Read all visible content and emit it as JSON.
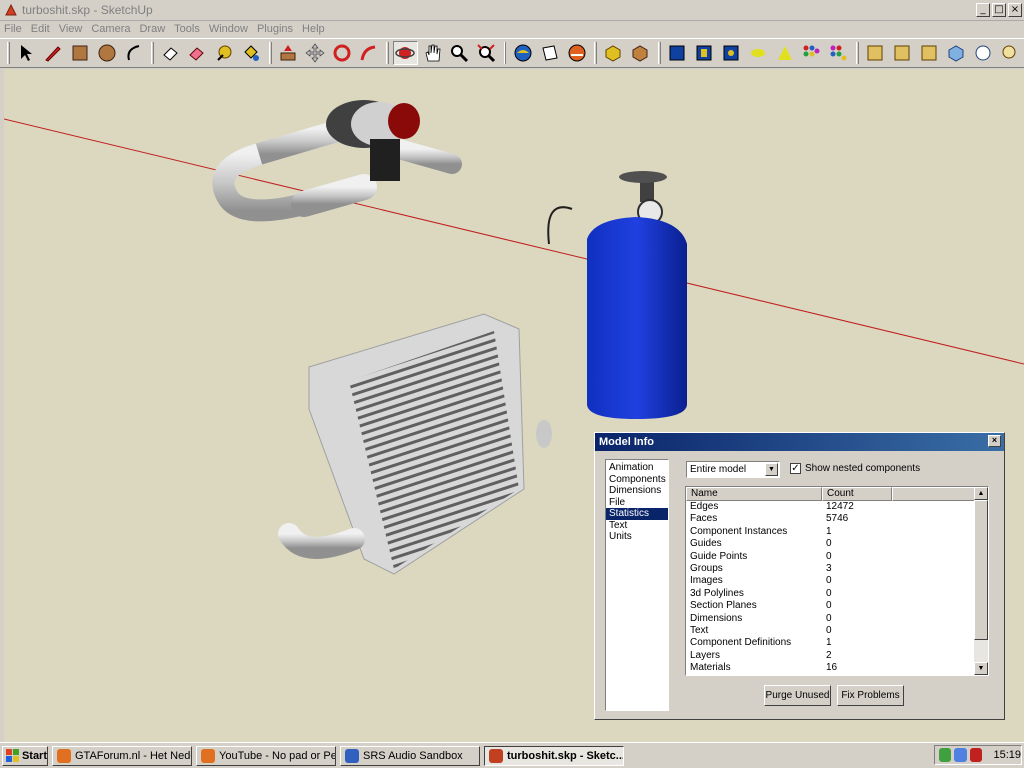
{
  "window": {
    "title": "turboshit.skp - SketchUp",
    "minimize": "_",
    "maximize": "□",
    "close": "×"
  },
  "menu": [
    "File",
    "Edit",
    "View",
    "Camera",
    "Draw",
    "Tools",
    "Window",
    "Plugins",
    "Help"
  ],
  "toolbar": {
    "tools": [
      "select-tool-icon",
      "pencil-icon",
      "rectangle-icon",
      "circle-icon",
      "arc-icon",
      "eraser-icon",
      "paint-bucket-icon",
      "tape-measure-icon",
      "push-pull-icon",
      "move-icon",
      "rotate-icon",
      "follow-me-icon",
      "orbit-icon",
      "pan-icon",
      "zoom-icon",
      "zoom-extents-icon",
      "walk-icon",
      "section-icon",
      "standard-views-icon",
      "component-icon",
      "shadows-icon",
      "layer-icon",
      "plugin-icon"
    ]
  },
  "dialog": {
    "title": "Model Info",
    "close": "×",
    "categories": [
      "Animation",
      "Components",
      "Dimensions",
      "File",
      "Statistics",
      "Text",
      "Units"
    ],
    "selected_category": "Statistics",
    "scope": "Entire model",
    "nested_checked": "✓",
    "nested_label": "Show nested components",
    "columns": [
      "Name",
      "Count"
    ],
    "rows": [
      {
        "name": "Edges",
        "count": "12472"
      },
      {
        "name": "Faces",
        "count": "5746"
      },
      {
        "name": "Component Instances",
        "count": "1"
      },
      {
        "name": "Guides",
        "count": "0"
      },
      {
        "name": "Guide Points",
        "count": "0"
      },
      {
        "name": "Groups",
        "count": "3"
      },
      {
        "name": "Images",
        "count": "0"
      },
      {
        "name": "3d Polylines",
        "count": "0"
      },
      {
        "name": "Section Planes",
        "count": "0"
      },
      {
        "name": "Dimensions",
        "count": "0"
      },
      {
        "name": "Text",
        "count": "0"
      },
      {
        "name": "Component Definitions",
        "count": "1"
      },
      {
        "name": "Layers",
        "count": "2"
      },
      {
        "name": "Materials",
        "count": "16"
      }
    ],
    "purge_label": "Purge Unused",
    "fix_label": "Fix Problems"
  },
  "taskbar": {
    "start": "Start",
    "tasks": [
      {
        "label": "GTAForum.nl - Het Nederl...",
        "color": "#e07020"
      },
      {
        "label": "YouTube - No pad or Pen...",
        "color": "#e07020"
      },
      {
        "label": "SRS Audio Sandbox",
        "color": "#3060c0"
      },
      {
        "label": "turboshit.skp - Sketc...",
        "color": "#c04020"
      }
    ],
    "active_task": 3,
    "clock": "15:19"
  }
}
